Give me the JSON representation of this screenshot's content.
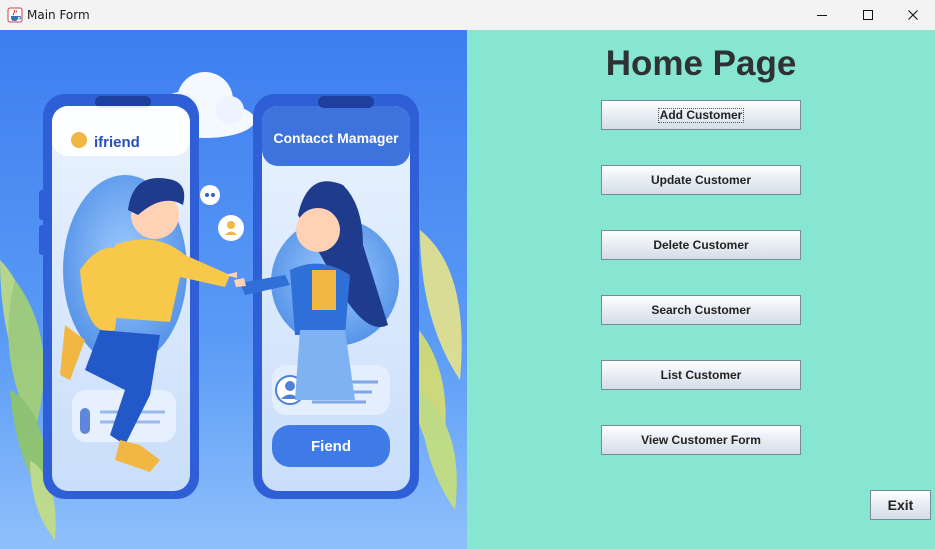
{
  "window": {
    "title": "Main Form",
    "icon": "java-cup-icon"
  },
  "illustration": {
    "left_phone_label": "ifriend",
    "right_phone_label": "Contacct Mamager",
    "right_phone_button": "Fiend"
  },
  "main": {
    "title": "Home Page",
    "buttons": [
      {
        "label": "Add Customer"
      },
      {
        "label": "Update Customer"
      },
      {
        "label": "Delete Customer"
      },
      {
        "label": "Search Customer"
      },
      {
        "label": "List Customer"
      },
      {
        "label": "View Customer Form"
      }
    ],
    "exit_label": "Exit"
  },
  "colors": {
    "right_panel_bg": "#86e6d2",
    "left_panel_bg": "#4d8ef5",
    "title_text": "#2e3232"
  }
}
